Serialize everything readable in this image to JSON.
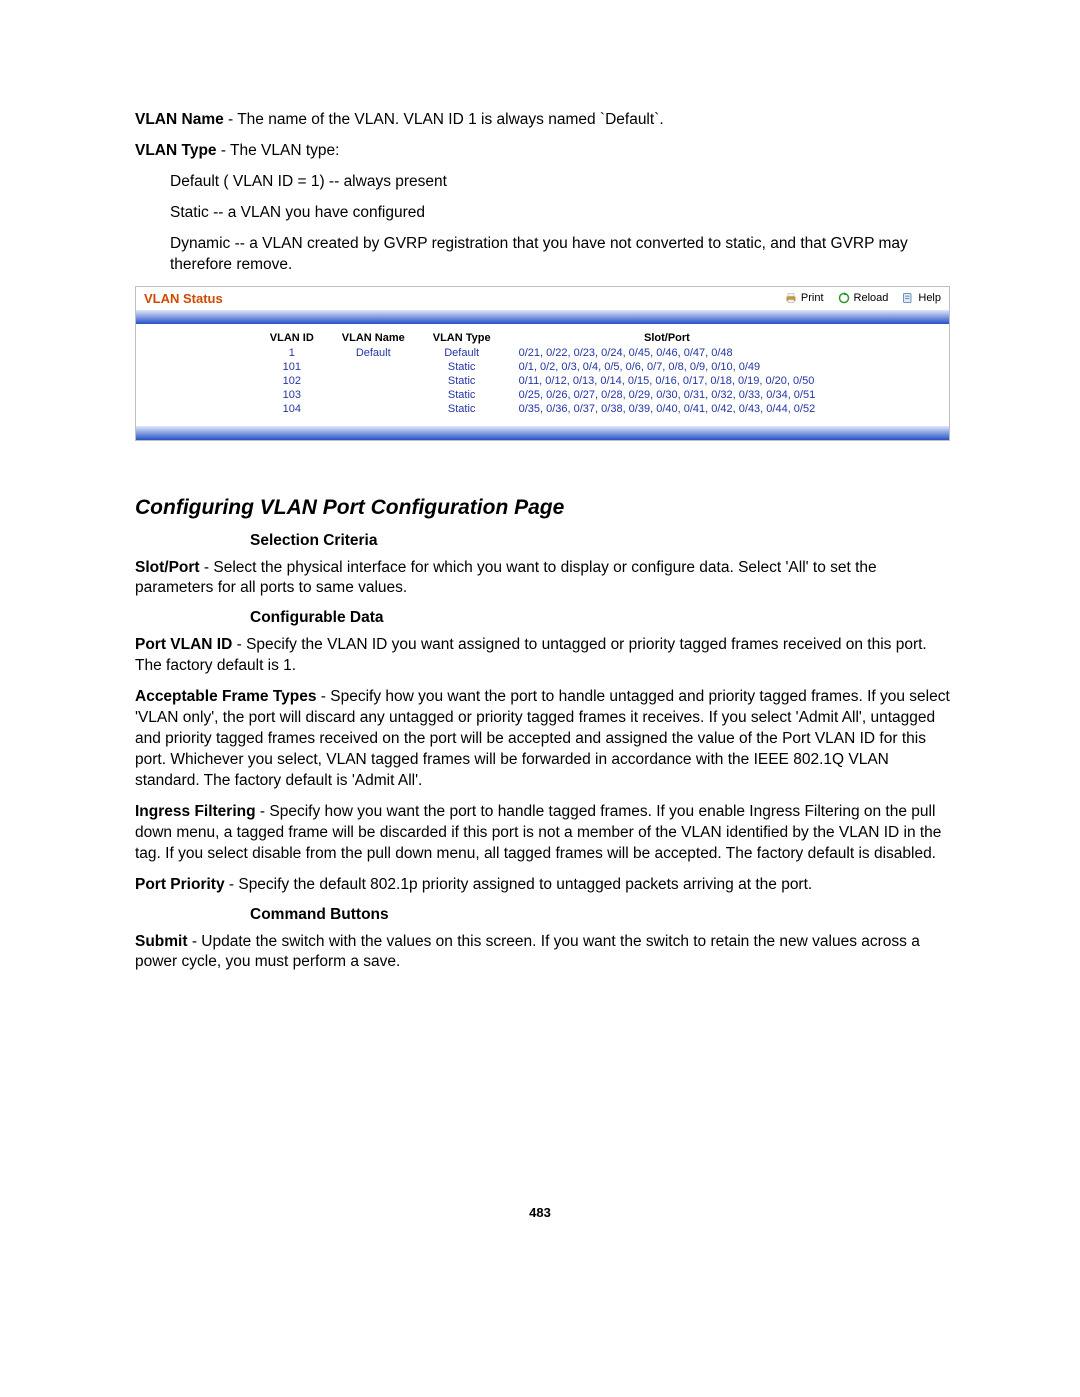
{
  "defs": {
    "vlan_name": {
      "label": "VLAN Name",
      "text": " - The name of the VLAN. VLAN ID 1 is always named `Default`."
    },
    "vlan_type": {
      "label": "VLAN Type",
      "text": " - The VLAN type:",
      "items": [
        "Default ( VLAN ID = 1) -- always present",
        "Static -- a VLAN you have configured",
        "Dynamic -- a VLAN created by GVRP registration that you have not converted to static, and that GVRP may therefore remove."
      ]
    }
  },
  "app": {
    "title": "VLAN Status",
    "actions": {
      "print": "Print",
      "reload": "Reload",
      "help": "Help"
    },
    "table": {
      "headers": {
        "id": "VLAN ID",
        "name": "VLAN Name",
        "type": "VLAN Type",
        "sp": "Slot/Port"
      },
      "rows": [
        {
          "id": "1",
          "name": "Default",
          "type": "Default",
          "sp": "0/21, 0/22, 0/23, 0/24, 0/45, 0/46, 0/47, 0/48"
        },
        {
          "id": "101",
          "name": "",
          "type": "Static",
          "sp": "0/1, 0/2, 0/3, 0/4, 0/5, 0/6, 0/7, 0/8, 0/9, 0/10, 0/49"
        },
        {
          "id": "102",
          "name": "",
          "type": "Static",
          "sp": "0/11, 0/12, 0/13, 0/14, 0/15, 0/16, 0/17, 0/18, 0/19, 0/20, 0/50"
        },
        {
          "id": "103",
          "name": "",
          "type": "Static",
          "sp": "0/25, 0/26, 0/27, 0/28, 0/29, 0/30, 0/31, 0/32, 0/33, 0/34, 0/51"
        },
        {
          "id": "104",
          "name": "",
          "type": "Static",
          "sp": "0/35, 0/36, 0/37, 0/38, 0/39, 0/40, 0/41, 0/42, 0/43, 0/44, 0/52"
        }
      ]
    }
  },
  "section": {
    "title": "Configuring VLAN Port Configuration Page",
    "sub1": "Selection Criteria",
    "slot_port": {
      "label": "Slot/Port",
      "text": " - Select the physical interface for which you want to display or configure data. Select 'All' to set the parameters for all ports to same values."
    },
    "sub2": "Configurable Data",
    "port_vlan_id": {
      "label": "Port VLAN ID",
      "text": " - Specify the VLAN ID you want assigned to untagged or priority tagged frames received on this port. The factory default is 1."
    },
    "acc_frame": {
      "label": "Acceptable Frame Types",
      "text": " - Specify how you want the port to handle untagged and priority tagged frames. If you select 'VLAN only', the port will discard any untagged or priority tagged frames it receives. If you select 'Admit All', untagged and priority tagged frames received on the port will be accepted and assigned the value of the Port VLAN ID for this port. Whichever you select, VLAN tagged frames will be forwarded in accordance with the IEEE 802.1Q VLAN standard. The factory default is 'Admit All'."
    },
    "ingress": {
      "label": "Ingress Filtering",
      "text": " - Specify how you want the port to handle tagged frames. If you enable Ingress Filtering on the pull down menu, a tagged frame will be discarded if this port is not a member of the VLAN identified by the VLAN ID in the tag. If you select disable from the pull down menu, all tagged frames will be accepted. The factory default is disabled."
    },
    "port_prio": {
      "label": "Port Priority",
      "text": " - Specify the default 802.1p priority assigned to untagged packets arriving at the port."
    },
    "sub3": "Command Buttons",
    "submit": {
      "label": "Submit",
      "text": " - Update the switch with the values on this screen. If you want the switch to retain the new values across a power cycle, you must perform a save."
    }
  },
  "page_number": "483"
}
